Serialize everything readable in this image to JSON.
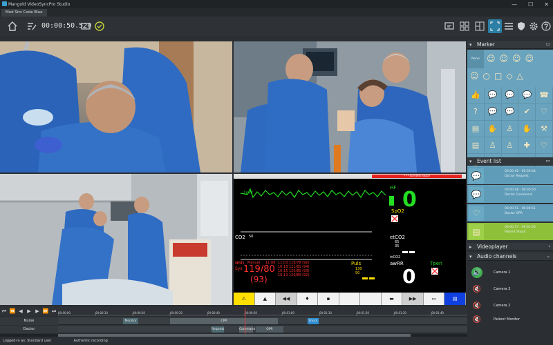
{
  "window": {
    "title": "Mangold VideoSyncPro Studio",
    "minimize": "—",
    "maximize": "☐",
    "close": "✕"
  },
  "tab": {
    "label": "Med Sim Code Blue"
  },
  "toolbar": {
    "timecode": "00:00:50.520"
  },
  "monitor": {
    "alarm": "* * * EXTREME BRADY",
    "hf_label": "HF",
    "hf_value": "0",
    "spo2_label": "SpO2",
    "co2_label": "CO2",
    "co2_scale": "50",
    "etco2_label": "etCO2",
    "etco2_vals": [
      "65",
      "35"
    ],
    "inco2_label": "inCO2",
    "nibp_label": "NBD",
    "nibp_mode": "Manuel",
    "nibp_time": "11:08",
    "nibp_sys_label": "Sys",
    "nibp_value": "119/80",
    "nibp_mean": "(93)",
    "nibp_history": [
      "11:03  118/78 (92)",
      "10:18  121/81 (94)",
      "10:15  120/80 (93)",
      "10:13  120/80 (92)"
    ],
    "puls_label": "Puls",
    "puls_vals": [
      "130",
      "50"
    ],
    "awrr_label": "awRR",
    "awrr_value": "0",
    "tperi_label": "Tperi"
  },
  "panel": {
    "marker_title": "Marker",
    "marker_first": "None",
    "event_title": "Event list",
    "events": [
      {
        "time": "00:00:40 - 00:00:44",
        "name": "Doctor Request"
      },
      {
        "time": "00:00:48 - 00:00:50",
        "name": "Doctor Command"
      },
      {
        "time": "00:00:51 - 00:00:51",
        "name": "Doctor OPR"
      },
      {
        "time": "00:00:57 - 00:01:05",
        "name": "Patient Shock"
      }
    ],
    "videoplayer_title": "Videoplayer",
    "audio_title": "Audio channels",
    "audio": [
      {
        "name": "Camera 1",
        "on": true
      },
      {
        "name": "Camera 3",
        "on": false
      },
      {
        "name": "Camera 2",
        "on": false
      },
      {
        "name": "Patient Monitor",
        "on": false
      }
    ]
  },
  "timeline": {
    "ticks": [
      "00:00:00",
      "00:00:10",
      "00:00:20",
      "00:00:30",
      "00:00:40",
      "00:00:50",
      "00:01:00",
      "00:01:10",
      "00:01:20",
      "00:01:30",
      "00:01:40"
    ],
    "tracks": [
      {
        "name": "Nurse",
        "segments": [
          {
            "label": "Monitor",
            "color": "#4e6a72"
          },
          {
            "label": "CPR",
            "color": "#5a6468"
          },
          {
            "label": "Shock",
            "color": "#2f8fd2"
          }
        ]
      },
      {
        "name": "Doctor",
        "segments": [
          {
            "label": "Request",
            "color": "#4e6a72"
          },
          {
            "label": "Command",
            "color": "#5a6468"
          },
          {
            "label": "OPR",
            "color": "#4e5a60"
          }
        ]
      }
    ]
  },
  "status": {
    "login": "Logged-in as: Standard user",
    "recording": "Authentic recording"
  },
  "colors": {
    "accent": "#2c7fa5",
    "marker_bg": "#6aa3bd",
    "event_green": "#8fc03a",
    "alarm_red": "#e52420",
    "monitor_green": "#22dd22",
    "monitor_red": "#ff3030",
    "monitor_yellow": "#ffe000"
  }
}
